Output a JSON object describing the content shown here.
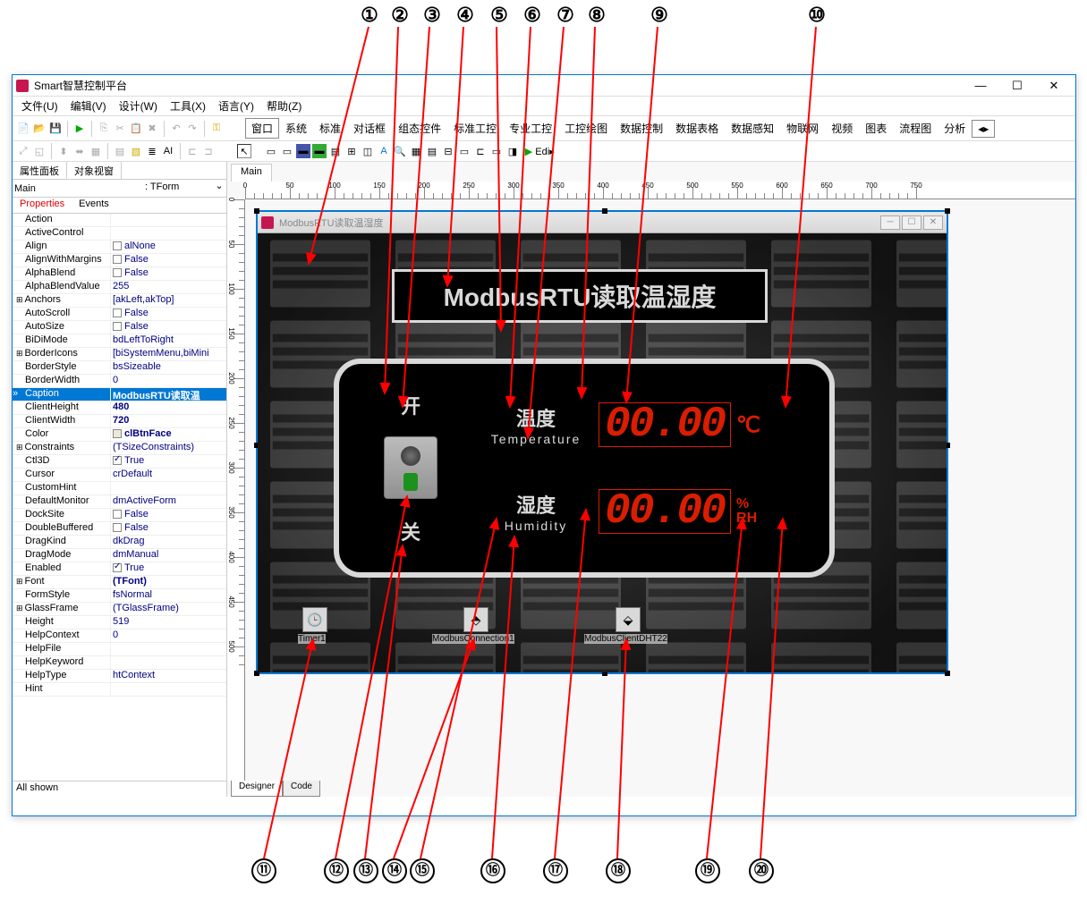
{
  "app": {
    "title": "Smart智慧控制平台",
    "min": "—",
    "max": "☐",
    "close": "✕"
  },
  "menubar": [
    "文件(U)",
    "编辑(V)",
    "设计(W)",
    "工具(X)",
    "语言(Y)",
    "帮助(Z)"
  ],
  "palette_tabs": [
    "窗口",
    "系统",
    "标准",
    "对话框",
    "组态控件",
    "标准工控",
    "专业工控",
    "工控绘图",
    "数据控制",
    "数据表格",
    "数据感知",
    "物联网",
    "视频",
    "图表",
    "流程图",
    "分析"
  ],
  "left_panel": {
    "tab_props": "属性面板",
    "tab_tree": "对象视窗",
    "obj_name": "Main",
    "obj_type": ": TForm",
    "sub_tab_props": "Properties",
    "sub_tab_events": "Events",
    "status": "All shown"
  },
  "properties": [
    {
      "n": "Action",
      "v": "",
      "exp": false
    },
    {
      "n": "ActiveControl",
      "v": "",
      "exp": false
    },
    {
      "n": "Align",
      "v": "alNone",
      "box": true
    },
    {
      "n": "AlignWithMargins",
      "v": "False",
      "cb": false
    },
    {
      "n": "AlphaBlend",
      "v": "False",
      "cb": false
    },
    {
      "n": "AlphaBlendValue",
      "v": "255"
    },
    {
      "n": "Anchors",
      "v": "[akLeft,akTop]",
      "exp": true
    },
    {
      "n": "AutoScroll",
      "v": "False",
      "cb": false
    },
    {
      "n": "AutoSize",
      "v": "False",
      "cb": false
    },
    {
      "n": "BiDiMode",
      "v": "bdLeftToRight"
    },
    {
      "n": "BorderIcons",
      "v": "[biSystemMenu,biMini",
      "exp": true
    },
    {
      "n": "BorderStyle",
      "v": "bsSizeable"
    },
    {
      "n": "BorderWidth",
      "v": "0"
    },
    {
      "n": "Caption",
      "v": "ModbusRTU读取温",
      "sel": true,
      "bold": true
    },
    {
      "n": "ClientHeight",
      "v": "480",
      "bold": true
    },
    {
      "n": "ClientWidth",
      "v": "720",
      "bold": true
    },
    {
      "n": "Color",
      "v": "clBtnFace",
      "colorbox": true,
      "bold": true
    },
    {
      "n": "Constraints",
      "v": "(TSizeConstraints)",
      "exp": true
    },
    {
      "n": "Ctl3D",
      "v": "True",
      "cb": true
    },
    {
      "n": "Cursor",
      "v": "crDefault"
    },
    {
      "n": "CustomHint",
      "v": ""
    },
    {
      "n": "DefaultMonitor",
      "v": "dmActiveForm"
    },
    {
      "n": "DockSite",
      "v": "False",
      "cb": false
    },
    {
      "n": "DoubleBuffered",
      "v": "False",
      "cb": false
    },
    {
      "n": "DragKind",
      "v": "dkDrag"
    },
    {
      "n": "DragMode",
      "v": "dmManual"
    },
    {
      "n": "Enabled",
      "v": "True",
      "cb": true
    },
    {
      "n": "Font",
      "v": "(TFont)",
      "exp": true,
      "bold": true
    },
    {
      "n": "FormStyle",
      "v": "fsNormal"
    },
    {
      "n": "GlassFrame",
      "v": "(TGlassFrame)",
      "exp": true
    },
    {
      "n": "Height",
      "v": "519"
    },
    {
      "n": "HelpContext",
      "v": "0"
    },
    {
      "n": "HelpFile",
      "v": ""
    },
    {
      "n": "HelpKeyword",
      "v": ""
    },
    {
      "n": "HelpType",
      "v": "htContext"
    },
    {
      "n": "Hint",
      "v": ""
    }
  ],
  "doc_tab": "Main",
  "form": {
    "title": "ModbusRTU读取温湿度",
    "headline": "ModbusRTU读取温湿度",
    "switch_on": "开",
    "switch_off": "关",
    "temp_cn": "温度",
    "temp_en": "Temperature",
    "temp_val": "00.00",
    "temp_unit": "℃",
    "hum_cn": "湿度",
    "hum_en": "Humidity",
    "hum_val": "00.00",
    "hum_unit": "%\nRH",
    "comp_timer": "Timer1",
    "comp_conn": "ModbusConnection1",
    "comp_client": "ModbusClientDHT22"
  },
  "bottom_tabs": {
    "design": "Designer",
    "code": "Code"
  },
  "callouts_top": [
    "①",
    "②",
    "③",
    "④",
    "⑤",
    "⑥",
    "⑦",
    "⑧",
    "⑨",
    "⑩"
  ],
  "callouts_bottom": [
    "⑪",
    "⑫",
    "⑬",
    "⑭",
    "⑮",
    "⑯",
    "⑰",
    "⑱",
    "⑲",
    "⑳"
  ]
}
